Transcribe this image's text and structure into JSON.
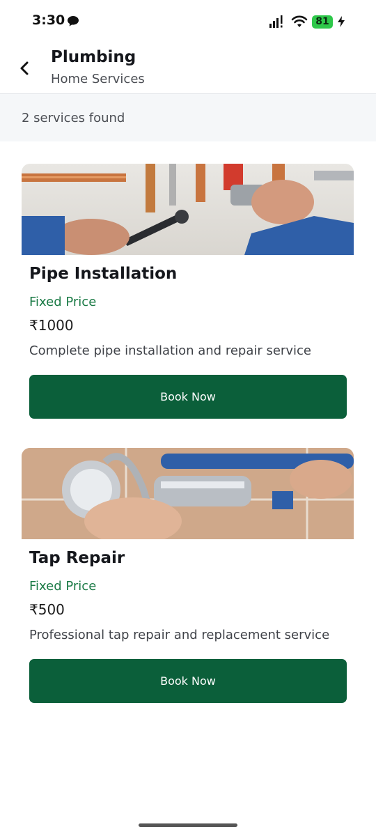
{
  "status_bar": {
    "time": "3:30",
    "battery_level": "81",
    "icons": [
      "message-icon",
      "signal-icon",
      "wifi-icon",
      "battery-icon",
      "charging-icon"
    ]
  },
  "header": {
    "title": "Plumbing",
    "subtitle": "Home Services",
    "back_icon": "chevron-left-icon"
  },
  "results": {
    "count_text": "2 services found"
  },
  "services": [
    {
      "name": "Pipe Installation",
      "price_type": "Fixed Price",
      "price": "₹1000",
      "description": "Complete pipe installation and repair service",
      "button_label": "Book Now"
    },
    {
      "name": "Tap Repair",
      "price_type": "Fixed Price",
      "price": "₹500",
      "description": "Professional tap repair and replacement service",
      "button_label": "Book Now"
    }
  ],
  "colors": {
    "accent": "#0b5f3a",
    "price_type": "#1a7a45",
    "battery": "#2ec84a",
    "results_bg": "#f5f7f9"
  }
}
